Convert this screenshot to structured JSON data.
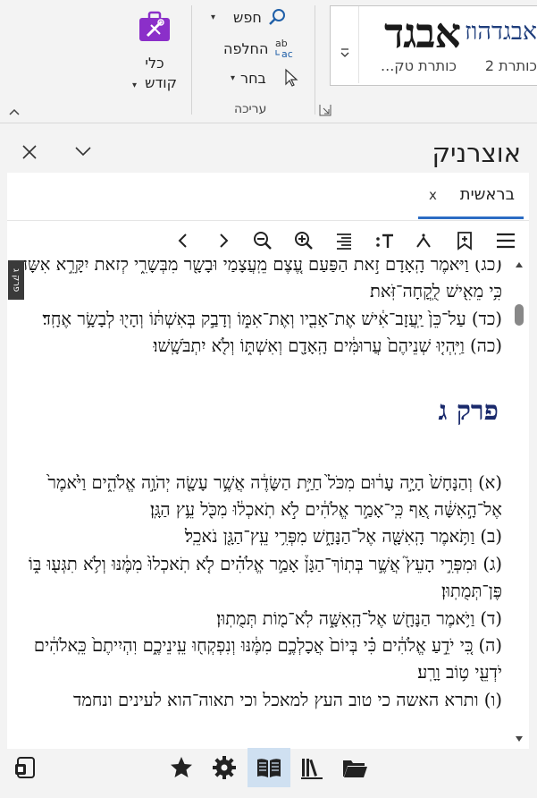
{
  "ribbon": {
    "styles": {
      "normal_sample": "אבגד",
      "normal_name": "כותרת טק...",
      "heading1_sample": "אבגדהוז",
      "heading2_name": "כותרת 2"
    },
    "editing": {
      "find_label": "חפש",
      "replace_label": "החלפה",
      "select_label": "בחר",
      "group_label": "עריכה"
    },
    "tools": {
      "label_line1": "כלי",
      "label_line2": "קודש"
    }
  },
  "panel": {
    "title": "אוצרניק",
    "tab_label": "בראשית",
    "tab_close": "x",
    "side_tab": "פרק ג",
    "text": {
      "verses_before": [
        "(כג) וַיֹּאמֶר֮ הָֽאָדָם֒ זֹ֣את הַפַּ֗עַם עֶ֚צֶם מֵֽעֲצָמַ֔י וּבָשָׂ֖ר מִבְּשָׂרִ֑י לְזֹאת֙ יִקָּרֵ֣א אִשָּׁ֔ה כִּ֥י מֵאִ֖ישׁ לֻֽקֳחָה־זֹּֽאת׃",
        "(כד) עַל־כֵּן֙ יַֽעֲזָב־אִ֔ישׁ אֶת־אָבִ֖יו וְאֶת־אִמּ֑וֹ וְדָבַ֣ק בְּאִשְׁתּ֔וֹ וְהָי֖וּ לְבָשָׂ֥ר אֶחָֽד׃",
        "(כה) וַיִּֽהְי֤וּ שְׁנֵיהֶם֙ עֲרוּמִּ֔ים הָֽאָדָ֖ם וְאִשְׁתּ֑וֹ וְלֹ֖א יִתְבֹּשָֽׁשׁוּ׃"
      ],
      "chapter_heading": "פרק ג",
      "verses_after": [
        "(א) וְהַנָּחָשׁ֙ הָיָ֣ה עָר֔וּם מִכֹּל֙ חַיַּ֣ת הַשָּׂדֶ֔ה אֲשֶׁ֥ר עָשָׂ֖ה יְהֹוָ֣ה אֱלֹהִ֑ים וַיֹּ֙אמֶר֙ אֶל־הָ֣אִשָּׁ֔ה אַ֚ף כִּֽי־אָמַ֣ר אֱלֹהִ֔ים לֹ֣א תֹֽאכְל֔וּ מִכֹּ֖ל עֵ֥ץ הַגָּֽן׃",
        "(ב) וַתֹּ֥אמֶר הָֽאִשָּׁ֖ה אֶל־הַנָּחָ֑שׁ מִפְּרִ֥י עֵֽץ־הַגָּ֖ן נֹאכֵֽל׃",
        "(ג) וּמִפְּרִ֣י הָעֵץ֮ אֲשֶׁ֣ר בְּתֽוֹךְ־הַגָּן֒ אָמַ֣ר אֱלֹהִ֗ים לֹ֤א תֹֽאכְלוּ֙ מִמֶּ֔נּוּ וְלֹ֥א תִגְּע֖וּ בּ֑וֹ פֶּן־תְּמֻתֽוּן׃",
        "(ד) וַיֹּ֥אמֶר הַנָּחָ֖שׁ אֶל־הָֽאִשָּׁ֑ה לֹֽא־מ֖וֹת תְּמֻתֽוּן׃",
        "(ה) כִּ֚י יֹדֵ֣עַ אֱלֹהִ֔ים כִּ֗י בְּיוֹם֙ אֲכָלְכֶ֣ם מִמֶּ֔נּוּ וְנִפְקְח֖וּ עֵֽינֵיכֶ֑ם וִהְיִיתֶם֙ כֵּֽאלֹהִ֔ים יֹדְעֵ֖י ט֥וֹב וָרָֽע׃",
        "(ו) ותרא האשה כי טוב העץ למאכל וכי תאוה־הוא לעינים ונחמד"
      ]
    }
  }
}
